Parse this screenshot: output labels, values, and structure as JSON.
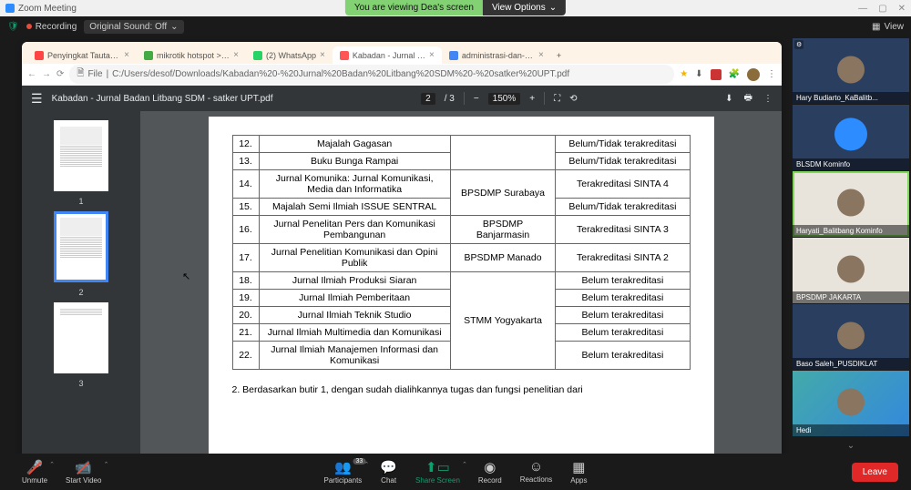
{
  "zoom": {
    "title": "Zoom Meeting",
    "recording": "Recording",
    "original_sound": "Original Sound: Off",
    "view": "View"
  },
  "sharing": {
    "message": "You are viewing Dea's screen",
    "options": "View Options"
  },
  "browser": {
    "tabs": [
      {
        "label": "Penyingkat Tautan Kominfo"
      },
      {
        "label": "mikrotik hotspot > redirect"
      },
      {
        "label": "(2) WhatsApp"
      },
      {
        "label": "Kabadan - Jurnal Badan Litbang"
      },
      {
        "label": "administrasi-dan-teknis - Googl"
      }
    ],
    "active_tab": 3,
    "url_prefix": "File",
    "url": "C:/Users/desof/Downloads/Kabadan%20-%20Jurnal%20Badan%20Litbang%20SDM%20-%20satker%20UPT.pdf"
  },
  "pdf": {
    "title": "Kabadan - Jurnal Badan Litbang SDM - satker UPT.pdf",
    "page_current": "2",
    "page_total": "/ 3",
    "zoom": "150%",
    "thumb_selected": 2,
    "rows": [
      {
        "n": "12.",
        "name": "Majalah Gagasan",
        "inst": "",
        "status": "Belum/Tidak terakreditasi",
        "inst_rowspan": 0,
        "inst_skip": true
      },
      {
        "n": "13.",
        "name": "Buku Bunga Rampai",
        "inst": "",
        "status": "Belum/Tidak terakreditasi",
        "inst_skip": true
      },
      {
        "n": "14.",
        "name": "Jurnal Komunika: Jurnal Komunikasi, Media dan Informatika",
        "inst": "BPSDMP Surabaya",
        "status": "Terakreditasi SINTA 4",
        "inst_rowspan": 2
      },
      {
        "n": "15.",
        "name": "Majalah Semi Ilmiah ISSUE SENTRAL",
        "status": "Belum/Tidak terakreditasi",
        "inst_skip": true
      },
      {
        "n": "16.",
        "name": "Jurnal Penelitan Pers dan Komunikasi Pembangunan",
        "inst": "BPSDMP Banjarmasin",
        "status": "Terakreditasi SINTA 3"
      },
      {
        "n": "17.",
        "name": "Jurnal Penelitian Komunikasi dan Opini Publik",
        "inst": "BPSDMP Manado",
        "status": "Terakreditasi SINTA 2"
      },
      {
        "n": "18.",
        "name": "Jurnal Ilmiah Produksi Siaran",
        "inst": "STMM Yogyakarta",
        "status": "Belum terakreditasi",
        "inst_rowspan": 5
      },
      {
        "n": "19.",
        "name": "Jurnal Ilmiah Pemberitaan",
        "status": "Belum terakreditasi",
        "inst_skip": true
      },
      {
        "n": "20.",
        "name": "Jurnal Ilmiah Teknik Studio",
        "status": "Belum terakreditasi",
        "inst_skip": true
      },
      {
        "n": "21.",
        "name": "Jurnal Ilmiah Multimedia dan Komunikasi",
        "status": "Belum terakreditasi",
        "inst_skip": true
      },
      {
        "n": "22.",
        "name": "Jurnal Ilmiah Manajemen Informasi dan Komunikasi",
        "status": "Belum terakreditasi",
        "inst_skip": true
      }
    ],
    "footer_text": "2.  Berdasarkan butir 1, dengan sudah dialihkannya tugas dan fungsi penelitian dari"
  },
  "participants_list": [
    {
      "name": "Hary Budiarto_KaBalitb...",
      "type": "person",
      "bg": "dark"
    },
    {
      "name": "BLSDM Kominfo",
      "type": "logo",
      "bg": "dark"
    },
    {
      "name": "Haryati_Balitbang Kominfo",
      "type": "person",
      "bg": "light",
      "speaking": true
    },
    {
      "name": "BPSDMP JAKARTA",
      "type": "person",
      "bg": "light"
    },
    {
      "name": "Baso Saleh_PUSDIKLAT",
      "type": "person",
      "bg": "dark"
    },
    {
      "name": "Hedi",
      "type": "person",
      "bg": "gradient"
    }
  ],
  "controls": {
    "unmute": "Unmute",
    "start_video": "Start Video",
    "participants": "Participants",
    "participants_count": "33",
    "chat": "Chat",
    "share_screen": "Share Screen",
    "record": "Record",
    "reactions": "Reactions",
    "apps": "Apps",
    "leave": "Leave"
  }
}
